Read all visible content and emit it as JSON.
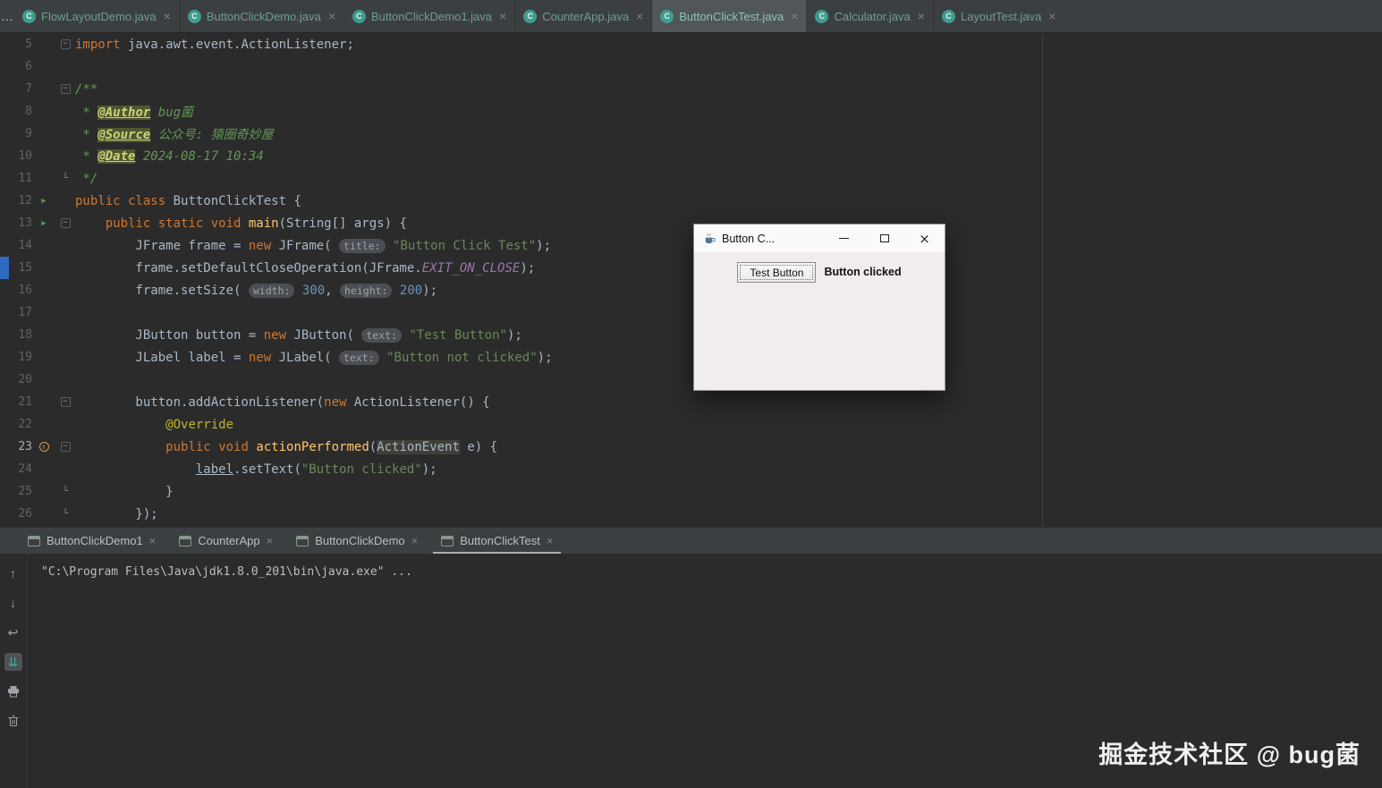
{
  "window": {
    "overflow_indicator": "…"
  },
  "editor_tabs": [
    {
      "label": "FlowLayoutDemo.java",
      "active": false
    },
    {
      "label": "ButtonClickDemo.java",
      "active": false
    },
    {
      "label": "ButtonClickDemo1.java",
      "active": false
    },
    {
      "label": "CounterApp.java",
      "active": false
    },
    {
      "label": "ButtonClickTest.java",
      "active": true
    },
    {
      "label": "Calculator.java",
      "active": false
    },
    {
      "label": "LayoutTest.java",
      "active": false
    }
  ],
  "editor": {
    "lines": [
      {
        "n": "5",
        "fold": "start",
        "tk": [
          [
            "k",
            "import"
          ],
          [
            "p",
            " java.awt.event.ActionListener;"
          ]
        ]
      },
      {
        "n": "6",
        "tk": []
      },
      {
        "n": "7",
        "fold": "start",
        "tk": [
          [
            "c",
            "/**"
          ]
        ]
      },
      {
        "n": "8",
        "tk": [
          [
            "c",
            " * "
          ],
          [
            "dt",
            "@Author"
          ],
          [
            "c",
            " bug菌"
          ]
        ]
      },
      {
        "n": "9",
        "tk": [
          [
            "c",
            " * "
          ],
          [
            "dt",
            "@Source"
          ],
          [
            "c",
            " 公众号: 猿圈奇妙屋"
          ]
        ]
      },
      {
        "n": "10",
        "tk": [
          [
            "c",
            " * "
          ],
          [
            "dt",
            "@Date"
          ],
          [
            "c",
            " 2024-08-17 10:34"
          ]
        ]
      },
      {
        "n": "11",
        "fold": "end",
        "tk": [
          [
            "c",
            " */"
          ]
        ]
      },
      {
        "n": "12",
        "run": true,
        "tk": [
          [
            "k",
            "public class"
          ],
          [
            "p",
            " ButtonClickTest {"
          ]
        ]
      },
      {
        "n": "13",
        "run": true,
        "fold": "start",
        "tk": [
          [
            "p",
            "    "
          ],
          [
            "k",
            "public static void"
          ],
          [
            "p",
            " "
          ],
          [
            "m",
            "main"
          ],
          [
            "p",
            "(String[] args) {"
          ]
        ]
      },
      {
        "n": "14",
        "tk": [
          [
            "p",
            "        JFrame frame = "
          ],
          [
            "k",
            "new"
          ],
          [
            "p",
            " JFrame( "
          ],
          [
            "h",
            "title:"
          ],
          [
            "p",
            " "
          ],
          [
            "s",
            "\"Button Click Test\""
          ],
          [
            "p",
            ");"
          ]
        ]
      },
      {
        "n": "15",
        "mark": true,
        "tk": [
          [
            "p",
            "        frame.setDefaultCloseOperation(JFrame."
          ],
          [
            "f",
            "EXIT_ON_CLOSE"
          ],
          [
            "p",
            ");"
          ]
        ]
      },
      {
        "n": "16",
        "tk": [
          [
            "p",
            "        frame.setSize( "
          ],
          [
            "h",
            "width:"
          ],
          [
            "p",
            " "
          ],
          [
            "n",
            "300"
          ],
          [
            "p",
            ", "
          ],
          [
            "h",
            "height:"
          ],
          [
            "p",
            " "
          ],
          [
            "n",
            "200"
          ],
          [
            "p",
            ");"
          ]
        ]
      },
      {
        "n": "17",
        "tk": []
      },
      {
        "n": "18",
        "tk": [
          [
            "p",
            "        JButton button = "
          ],
          [
            "k",
            "new"
          ],
          [
            "p",
            " JButton( "
          ],
          [
            "h",
            "text:"
          ],
          [
            "p",
            " "
          ],
          [
            "s",
            "\"Test Button\""
          ],
          [
            "p",
            ");"
          ]
        ]
      },
      {
        "n": "19",
        "tk": [
          [
            "p",
            "        JLabel label = "
          ],
          [
            "k",
            "new"
          ],
          [
            "p",
            " JLabel( "
          ],
          [
            "h",
            "text:"
          ],
          [
            "p",
            " "
          ],
          [
            "s",
            "\"Button not clicked\""
          ],
          [
            "p",
            ");"
          ]
        ]
      },
      {
        "n": "20",
        "tk": []
      },
      {
        "n": "21",
        "fold": "start",
        "tk": [
          [
            "p",
            "        button.addActionListener("
          ],
          [
            "k",
            "new"
          ],
          [
            "p",
            " ActionListener() {"
          ]
        ]
      },
      {
        "n": "22",
        "tk": [
          [
            "p",
            "            "
          ],
          [
            "a",
            "@Override"
          ]
        ]
      },
      {
        "n": "23",
        "cur": true,
        "ovr": true,
        "fold": "start",
        "tk": [
          [
            "p",
            "            "
          ],
          [
            "k",
            "public void"
          ],
          [
            "p",
            " "
          ],
          [
            "m",
            "actionPerformed"
          ],
          [
            "p",
            "("
          ],
          [
            "e",
            "ActionEvent"
          ],
          [
            "p",
            " e) {"
          ]
        ]
      },
      {
        "n": "24",
        "tk": [
          [
            "p",
            "                "
          ],
          [
            "u",
            "label"
          ],
          [
            "p",
            ".setText("
          ],
          [
            "s",
            "\"Button clicked\""
          ],
          [
            "p",
            ");"
          ]
        ]
      },
      {
        "n": "25",
        "fold": "end",
        "tk": [
          [
            "p",
            "            }"
          ]
        ]
      },
      {
        "n": "26",
        "fold": "end",
        "tk": [
          [
            "p",
            "        });"
          ]
        ]
      }
    ]
  },
  "dialog": {
    "title": "Button C...",
    "button_label": "Test Button",
    "status_label": "Button clicked"
  },
  "run_tabs": [
    {
      "label": "ButtonClickDemo1",
      "active": false
    },
    {
      "label": "CounterApp",
      "active": false
    },
    {
      "label": "ButtonClickDemo",
      "active": false
    },
    {
      "label": "ButtonClickTest",
      "active": true
    }
  ],
  "console": {
    "output": "\"C:\\Program Files\\Java\\jdk1.8.0_201\\bin\\java.exe\" ...",
    "toolbar": [
      {
        "name": "up-arrow-icon",
        "selected": false
      },
      {
        "name": "down-arrow-icon",
        "selected": false
      },
      {
        "name": "soft-wrap-icon",
        "selected": false
      },
      {
        "name": "scroll-to-end-icon",
        "selected": true
      },
      {
        "name": "print-icon",
        "selected": false
      },
      {
        "name": "clear-icon",
        "selected": false
      }
    ]
  },
  "watermark": "掘金技术社区 @ bug菌",
  "colors": {
    "editor_bg": "#2b2b2b",
    "bar_bg": "#3c3f41",
    "keyword": "#cc7832",
    "string": "#6a8759",
    "comment": "#629755",
    "class_icon": "#3f9d8d",
    "run_arrow": "#4e9b57",
    "gutter_mark_blue": "#3069c0"
  }
}
